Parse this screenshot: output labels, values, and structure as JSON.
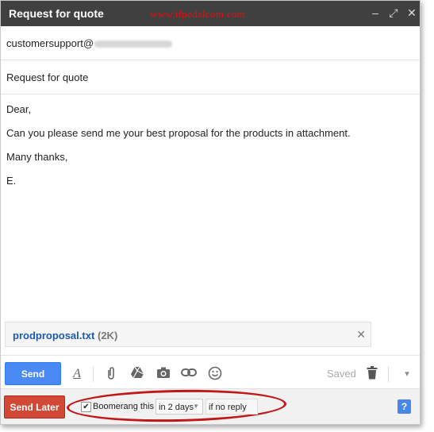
{
  "window": {
    "title": "Request for quote",
    "watermark": "www.ifpedalcom.com",
    "controls": {
      "minimize": "–",
      "popout": "⤢",
      "close": "✕"
    }
  },
  "to": {
    "value": "customersupport@"
  },
  "subject": {
    "value": "Request for quote"
  },
  "body": {
    "lines": [
      "Dear,",
      "Can you please send me your best proposal for the products in attachment.",
      "Many thanks,",
      "E."
    ]
  },
  "attachment": {
    "name": "prodproposal.txt",
    "size": "(2K)",
    "remove_icon": "✕"
  },
  "toolbar": {
    "send_label": "Send",
    "saved_label": "Saved",
    "icons": {
      "format": "A",
      "attach": "paperclip-icon",
      "drive": "drive-icon",
      "photo": "camera-icon",
      "link": "link-icon",
      "emoji": "smiley-icon",
      "trash": "trash-icon",
      "more": "▾"
    }
  },
  "boomerang": {
    "send_later_label": "Send Later",
    "checkbox_checked": true,
    "checkbox_label": "Boomerang this",
    "days_value": "in 2 days",
    "condition_value": "if no reply",
    "help_icon": "?"
  },
  "colors": {
    "titlebar": "#404040",
    "send": "#4a8af4",
    "send_later": "#d14836",
    "link_blue": "#1a5bb0",
    "highlight_oval": "#c01818"
  }
}
